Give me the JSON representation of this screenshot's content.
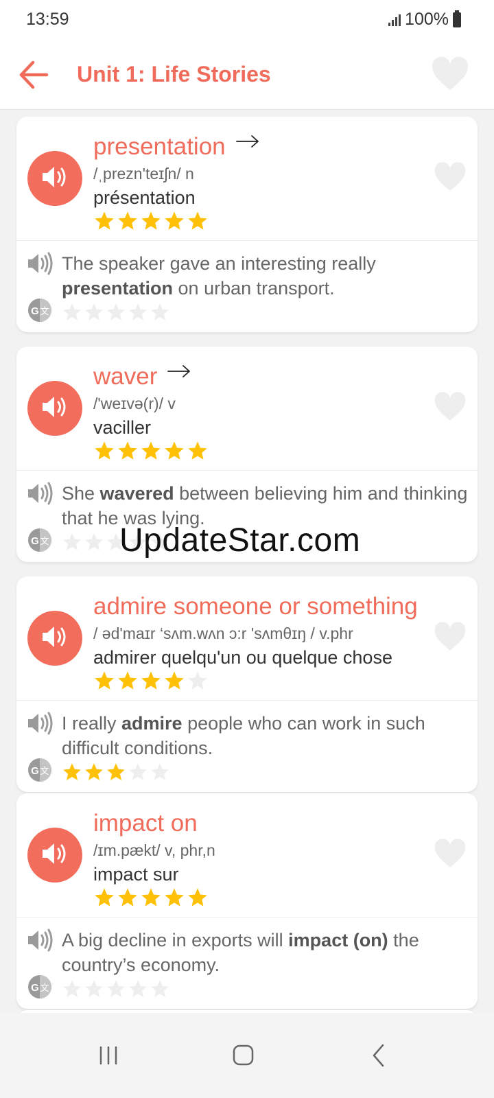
{
  "status": {
    "time": "13:59",
    "battery": "100%"
  },
  "appbar": {
    "title": "Unit 1: Life Stories"
  },
  "cards": [
    {
      "word": "presentation",
      "has_arrow": true,
      "phonetic": "/ˌprezn'teɪʃn/ n",
      "translation": "présentation",
      "word_rating": 5,
      "example_before": "The speaker gave an interesting really ",
      "example_bold": "presentation",
      "example_after": " on urban transport.",
      "example_rating": 0
    },
    {
      "word": "waver",
      "has_arrow": true,
      "phonetic": "/'weɪvə(r)/ v",
      "translation": "vaciller",
      "word_rating": 5,
      "example_before": "She ",
      "example_bold": "wavered",
      "example_after": " between believing him and thinking that he was lying.",
      "example_rating": 0
    },
    {
      "word": "admire someone or something",
      "has_arrow": false,
      "phonetic": "/ əd'maɪr ‘sʌm.wʌn ɔ:r 'sʌmθɪŋ / v.phr",
      "translation": "admirer quelqu'un ou quelque chose",
      "word_rating": 4,
      "example_before": "I really ",
      "example_bold": "admire",
      "example_after": " people who can work in such difficult conditions.",
      "example_rating": 3
    },
    {
      "word": "impact on",
      "has_arrow": false,
      "phonetic": "/ɪm.pækt/  v, phr,n",
      "translation": "impact sur",
      "word_rating": 5,
      "example_before": "A big decline in exports will ",
      "example_bold": "impact (on)",
      "example_after": " the country’s economy.",
      "example_rating": 0
    }
  ],
  "watermark": "UpdateStar.com",
  "colors": {
    "accent": "#f06b5a",
    "star_on": "#ffc107",
    "star_off": "#eeeeee"
  },
  "icons": {
    "back": "arrow-left-icon",
    "favorite": "heart-icon",
    "speaker": "speaker-icon",
    "translate": "google-translate-icon",
    "star": "star-icon",
    "nav_recents": "recents-icon",
    "nav_home": "home-icon",
    "nav_back": "chevron-left-icon"
  }
}
